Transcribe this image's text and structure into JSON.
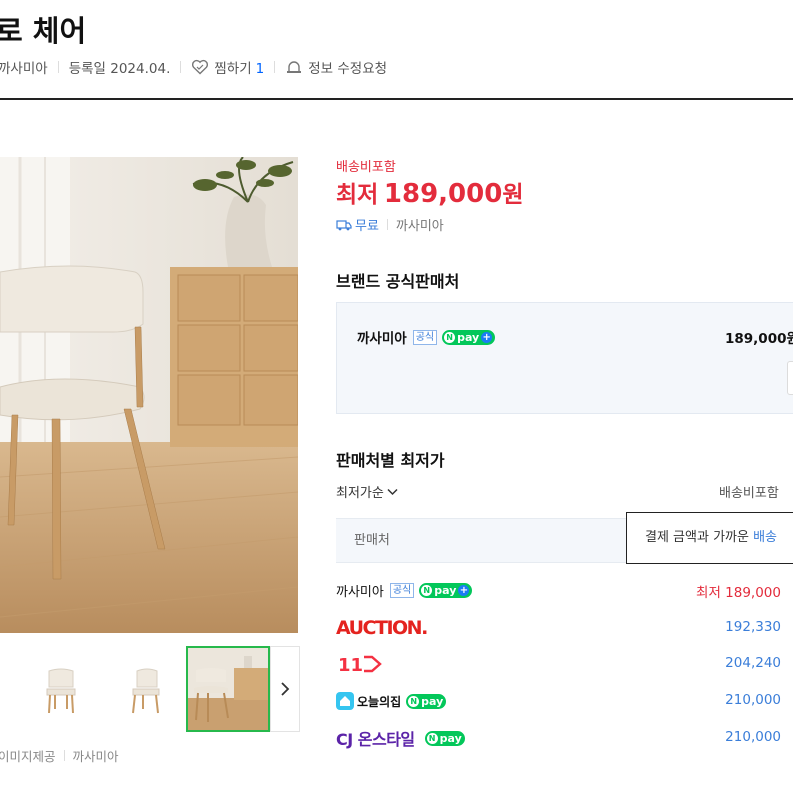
{
  "product": {
    "title": "로 체어",
    "seller": "까사미아",
    "registered": "등록일 2024.04.",
    "like_label": "찜하기",
    "like_count": "1",
    "report_label": "정보 수정요청"
  },
  "gallery": {
    "image_credit": "이미지제공",
    "image_credit_seller": "까사미아",
    "thumbnail_count": 3
  },
  "price": {
    "shipping_note": "배송비포함",
    "lowest_label": "최저",
    "lowest_amount": "189,000",
    "currency": "원",
    "delivery_free": "무료",
    "delivery_seller": "까사미아"
  },
  "brand_section": {
    "heading": "브랜드 공식판매처",
    "seller": "까사미아",
    "official_tag": "공식",
    "npay_label": "pay",
    "price": "189,000원"
  },
  "seller_section": {
    "heading": "판매처별 최저가",
    "sort_label": "최저가순",
    "shipping_included": "배송비포함",
    "seller_column": "판매처",
    "payment_hint_prefix": "결제 금액과 가까운",
    "payment_hint_highlight": "배송",
    "offers": [
      {
        "seller": "까사미아",
        "official_tag": "공식",
        "npay": "pay",
        "price": "최저 189,000",
        "lowest": true
      },
      {
        "seller": "AUCTION.",
        "price": "192,330"
      },
      {
        "seller": "11",
        "price": "204,240"
      },
      {
        "seller": "오늘의집",
        "npay": "pay",
        "price": "210,000"
      },
      {
        "seller": "CJ 온스타일",
        "npay": "pay",
        "price": "210,000"
      }
    ]
  },
  "colors": {
    "accent_red": "#e32c3c",
    "link_blue": "#3b7ed9",
    "npay_green": "#03c75a",
    "selected_thumb": "#27b94c"
  }
}
